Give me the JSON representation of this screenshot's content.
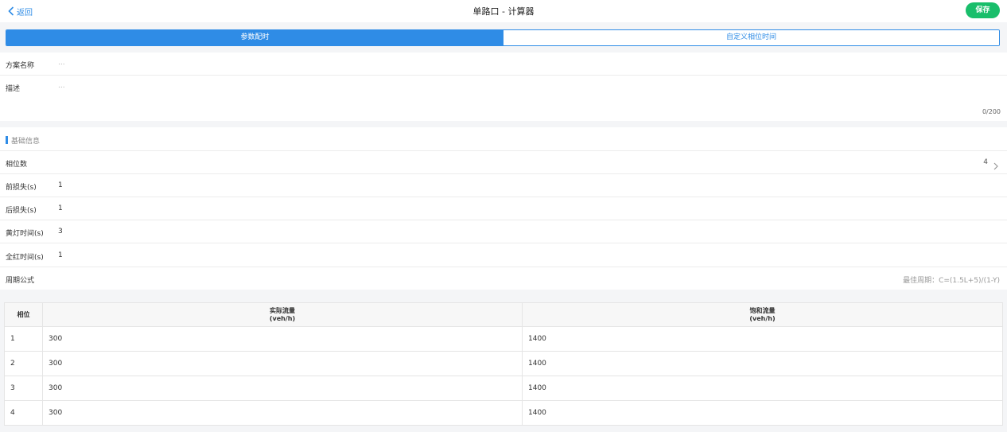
{
  "header": {
    "back_label": "返回",
    "title": "单路口 - 计算器",
    "save_label": "保存"
  },
  "tabs": [
    {
      "label": "参数配时",
      "active": true
    },
    {
      "label": "自定义相位时间",
      "active": false
    }
  ],
  "plan": {
    "name_label": "方案名称",
    "name_placeholder": "...",
    "desc_label": "描述",
    "desc_placeholder": "...",
    "desc_count": "0/200"
  },
  "basic_info": {
    "section_title": "基础信息",
    "phase_count_label": "相位数",
    "phase_count_value": "4",
    "front_loss_label": "前损失(s)",
    "front_loss_value": "1",
    "rear_loss_label": "后损失(s)",
    "rear_loss_value": "1",
    "yellow_label": "黄灯时间(s)",
    "yellow_value": "3",
    "allred_label": "全红时间(s)",
    "allred_value": "1",
    "cycle_label": "周期公式",
    "cycle_formula": "最佳周期：C=(1.5L+5)/(1-Y)"
  },
  "table": {
    "headers": [
      {
        "line1": "相位",
        "line2": ""
      },
      {
        "line1": "实际流量",
        "line2": "(veh/h)"
      },
      {
        "line1": "饱和流量",
        "line2": "(veh/h)"
      }
    ],
    "rows": [
      [
        "1",
        "300",
        "1400"
      ],
      [
        "2",
        "300",
        "1400"
      ],
      [
        "3",
        "300",
        "1400"
      ],
      [
        "4",
        "300",
        "1400"
      ]
    ]
  },
  "colors": {
    "accent": "#2f8ce6",
    "save_green": "#19be6b"
  }
}
